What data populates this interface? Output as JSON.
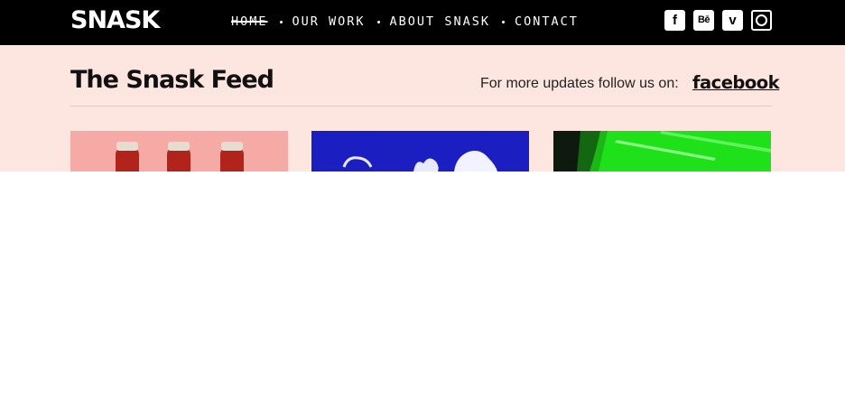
{
  "header": {
    "logo": "SNASK",
    "nav": [
      {
        "label": "HOME",
        "active": true
      },
      {
        "label": "OUR WORK",
        "active": false
      },
      {
        "label": "ABOUT SNASK",
        "active": false
      },
      {
        "label": "CONTACT",
        "active": false
      }
    ],
    "social": [
      {
        "icon": "facebook-icon",
        "glyph": "f"
      },
      {
        "icon": "behance-icon",
        "glyph": "Bē"
      },
      {
        "icon": "vimeo-icon",
        "glyph": "v"
      },
      {
        "icon": "instagram-icon",
        "glyph": ""
      }
    ]
  },
  "feed": {
    "title": "The Snask Feed",
    "follow_text": "For more updates follow us on:",
    "facebook_label": "facebook"
  },
  "colors": {
    "header_bg": "#000000",
    "feed_bg": "#fde5e0",
    "thumb1": "#f6aaa6",
    "thumb2": "#1b1fc2",
    "thumb3": "#1ee11a"
  }
}
